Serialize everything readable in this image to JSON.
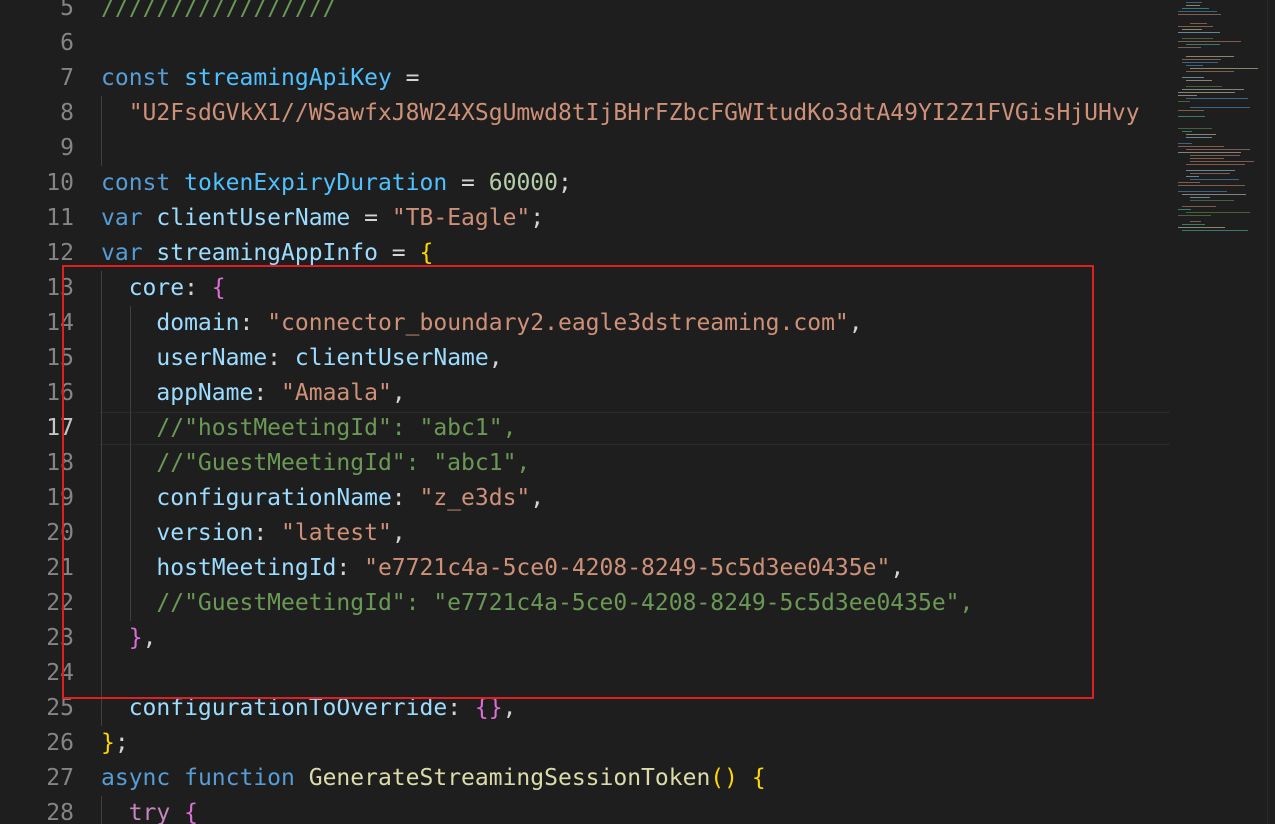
{
  "editor": {
    "current_line_number": "17",
    "lines": [
      {
        "n": "5",
        "tokens": [
          {
            "t": "/////////////////",
            "c": "cmt"
          }
        ]
      },
      {
        "n": "6",
        "tokens": []
      },
      {
        "n": "7",
        "tokens": [
          {
            "t": "const ",
            "c": "kw"
          },
          {
            "t": "streamingApiKey",
            "c": "cvar"
          },
          {
            "t": " =",
            "c": "pun"
          }
        ]
      },
      {
        "n": "8",
        "tokens": [
          {
            "t": "  ",
            "c": "pun"
          },
          {
            "t": "\"U2FsdGVkX1//WSawfxJ8W24XSgUmwd8tIjBHrFZbcFGWItudKo3dtA49YI2Z1FVGisHjUHvy",
            "c": "str"
          }
        ]
      },
      {
        "n": "9",
        "tokens": []
      },
      {
        "n": "10",
        "tokens": [
          {
            "t": "const ",
            "c": "kw"
          },
          {
            "t": "tokenExpiryDuration",
            "c": "cvar"
          },
          {
            "t": " = ",
            "c": "pun"
          },
          {
            "t": "60000",
            "c": "num"
          },
          {
            "t": ";",
            "c": "pun"
          }
        ]
      },
      {
        "n": "11",
        "tokens": [
          {
            "t": "var ",
            "c": "kw"
          },
          {
            "t": "clientUserName",
            "c": "var"
          },
          {
            "t": " = ",
            "c": "pun"
          },
          {
            "t": "\"TB-Eagle\"",
            "c": "str"
          },
          {
            "t": ";",
            "c": "pun"
          }
        ]
      },
      {
        "n": "12",
        "tokens": [
          {
            "t": "var ",
            "c": "kw"
          },
          {
            "t": "streamingAppInfo",
            "c": "var"
          },
          {
            "t": " = ",
            "c": "pun"
          },
          {
            "t": "{",
            "c": "b1"
          }
        ]
      },
      {
        "n": "13",
        "tokens": [
          {
            "t": "  core",
            "c": "var"
          },
          {
            "t": ": ",
            "c": "pun"
          },
          {
            "t": "{",
            "c": "b2"
          }
        ]
      },
      {
        "n": "14",
        "tokens": [
          {
            "t": "    domain",
            "c": "var"
          },
          {
            "t": ": ",
            "c": "pun"
          },
          {
            "t": "\"connector_boundary2.eagle3dstreaming.com\"",
            "c": "str"
          },
          {
            "t": ",",
            "c": "pun"
          }
        ]
      },
      {
        "n": "15",
        "tokens": [
          {
            "t": "    userName",
            "c": "var"
          },
          {
            "t": ": ",
            "c": "pun"
          },
          {
            "t": "clientUserName",
            "c": "var"
          },
          {
            "t": ",",
            "c": "pun"
          }
        ]
      },
      {
        "n": "16",
        "tokens": [
          {
            "t": "    appName",
            "c": "var"
          },
          {
            "t": ": ",
            "c": "pun"
          },
          {
            "t": "\"Amaala\"",
            "c": "str"
          },
          {
            "t": ",",
            "c": "pun"
          }
        ]
      },
      {
        "n": "17",
        "tokens": [
          {
            "t": "    //\"hostMeetingId\": \"abc1\",",
            "c": "cmt"
          }
        ]
      },
      {
        "n": "18",
        "tokens": [
          {
            "t": "    //\"GuestMeetingId\": \"abc1\",",
            "c": "cmt"
          }
        ]
      },
      {
        "n": "19",
        "tokens": [
          {
            "t": "    configurationName",
            "c": "var"
          },
          {
            "t": ": ",
            "c": "pun"
          },
          {
            "t": "\"z_e3ds\"",
            "c": "str"
          },
          {
            "t": ",",
            "c": "pun"
          }
        ]
      },
      {
        "n": "20",
        "tokens": [
          {
            "t": "    version",
            "c": "var"
          },
          {
            "t": ": ",
            "c": "pun"
          },
          {
            "t": "\"latest\"",
            "c": "str"
          },
          {
            "t": ",",
            "c": "pun"
          }
        ]
      },
      {
        "n": "21",
        "tokens": [
          {
            "t": "    hostMeetingId",
            "c": "var"
          },
          {
            "t": ": ",
            "c": "pun"
          },
          {
            "t": "\"e7721c4a-5ce0-4208-8249-5c5d3ee0435e\"",
            "c": "str"
          },
          {
            "t": ",",
            "c": "pun"
          }
        ]
      },
      {
        "n": "22",
        "tokens": [
          {
            "t": "    //\"GuestMeetingId\": \"e7721c4a-5ce0-4208-8249-5c5d3ee0435e\",",
            "c": "cmt"
          }
        ]
      },
      {
        "n": "23",
        "tokens": [
          {
            "t": "  ",
            "c": "pun"
          },
          {
            "t": "}",
            "c": "b2"
          },
          {
            "t": ",",
            "c": "pun"
          }
        ]
      },
      {
        "n": "24",
        "tokens": []
      },
      {
        "n": "25",
        "tokens": [
          {
            "t": "  configurationToOverride",
            "c": "var"
          },
          {
            "t": ": ",
            "c": "pun"
          },
          {
            "t": "{}",
            "c": "b2"
          },
          {
            "t": ",",
            "c": "pun"
          }
        ]
      },
      {
        "n": "26",
        "tokens": [
          {
            "t": "}",
            "c": "b1"
          },
          {
            "t": ";",
            "c": "pun"
          }
        ]
      },
      {
        "n": "27",
        "tokens": [
          {
            "t": "async ",
            "c": "kw"
          },
          {
            "t": "function ",
            "c": "kw"
          },
          {
            "t": "GenerateStreamingSessionToken",
            "c": "fn"
          },
          {
            "t": "() ",
            "c": "b1"
          },
          {
            "t": "{",
            "c": "b1"
          }
        ]
      },
      {
        "n": "28",
        "tokens": [
          {
            "t": "  try ",
            "c": "ctl"
          },
          {
            "t": "{",
            "c": "b2"
          }
        ]
      }
    ]
  },
  "colors": {
    "background": "#1e1e1e",
    "highlight_box": "#e02020",
    "line_number": "#858585",
    "active_line_number": "#c6c6c6"
  }
}
